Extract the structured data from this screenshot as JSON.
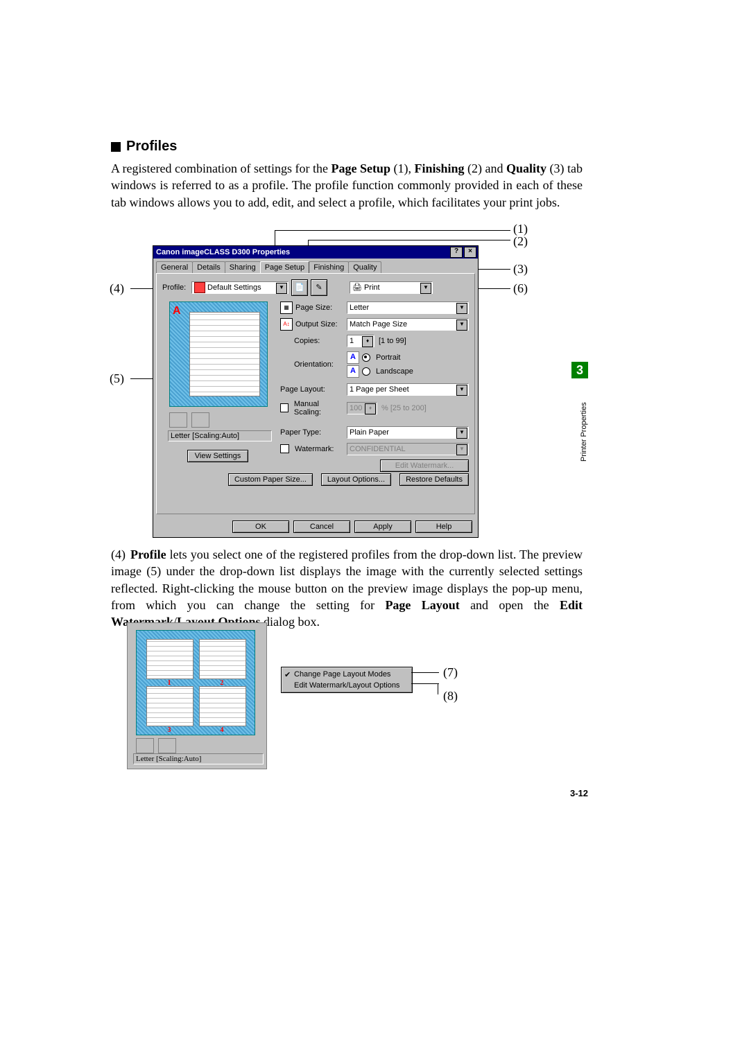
{
  "heading": "Profiles",
  "intro": "A registered combination of settings for the ",
  "intro_b1": "Page Setup",
  "intro_mid1": " (1), ",
  "intro_b2": "Finishing",
  "intro_mid2": " (2) and ",
  "intro_b3": "Quality",
  "intro_mid3": " (3) tab windows is referred to as a profile. The profile function commonly provided in each of these tab windows allows you to add, edit, and select a profile, which facilitates your print jobs.",
  "callouts": {
    "c1": "(1)",
    "c2": "(2)",
    "c3": "(3)",
    "c4": "(4)",
    "c5": "(5)",
    "c6": "(6)",
    "c7": "(7)",
    "c8": "(8)"
  },
  "dialog": {
    "title": "Canon imageCLASS D300 Properties",
    "help_btn": "?",
    "close_btn": "×",
    "tabs": {
      "general": "General",
      "details": "Details",
      "sharing": "Sharing",
      "page_setup": "Page Setup",
      "finishing": "Finishing",
      "quality": "Quality"
    },
    "profile_label": "Profile:",
    "profile_value": "Default Settings",
    "print_label": "Print",
    "page_size_label": "Page Size:",
    "page_size_value": "Letter",
    "output_size_label": "Output Size:",
    "output_size_value": "Match Page Size",
    "copies_label": "Copies:",
    "copies_value": "1",
    "copies_range": "[1 to 99]",
    "orientation_label": "Orientation:",
    "orientation_portrait": "Portrait",
    "orientation_landscape": "Landscape",
    "page_layout_label": "Page Layout:",
    "page_layout_value": "1 Page per Sheet",
    "manual_scaling_label": "Manual Scaling:",
    "manual_scaling_value": "100",
    "manual_scaling_range": "% [25 to 200]",
    "paper_type_label": "Paper Type:",
    "paper_type_value": "Plain Paper",
    "watermark_label": "Watermark:",
    "watermark_value": "CONFIDENTIAL",
    "edit_watermark_btn": "Edit Watermark...",
    "view_settings_btn": "View Settings",
    "custom_paper_btn": "Custom Paper Size...",
    "layout_options_btn": "Layout Options...",
    "restore_defaults_btn": "Restore Defaults",
    "ok_btn": "OK",
    "cancel_btn": "Cancel",
    "apply_btn": "Apply",
    "help_btn2": "Help",
    "preview_caption": "Letter [Scaling:Auto]"
  },
  "para4_num": "(4)",
  "para4_b1": "Profile",
  "para4_t1": " lets you select one of the registered profiles from the drop-down list. The preview image (5) under the drop-down list displays the image with the currently selected settings reflected. Right-clicking the mouse button on the preview image displays the pop-up menu, from which you can change the setting for ",
  "para4_b2": "Page Layout",
  "para4_t2": " and open the ",
  "para4_b3": "Edit Watermark",
  "para4_slash": "/",
  "para4_b4": "Layout Options",
  "para4_t3": " dialog box.",
  "fig2": {
    "caption": "Letter [Scaling:Auto]",
    "menu_item1": "Change Page Layout Modes",
    "menu_item2": "Edit Watermark/Layout Options",
    "q1": "1",
    "q2": "2",
    "q3": "3",
    "q4": "4"
  },
  "side": {
    "chapter": "3",
    "label": "Printer Properties",
    "pagenum": "3-12"
  }
}
